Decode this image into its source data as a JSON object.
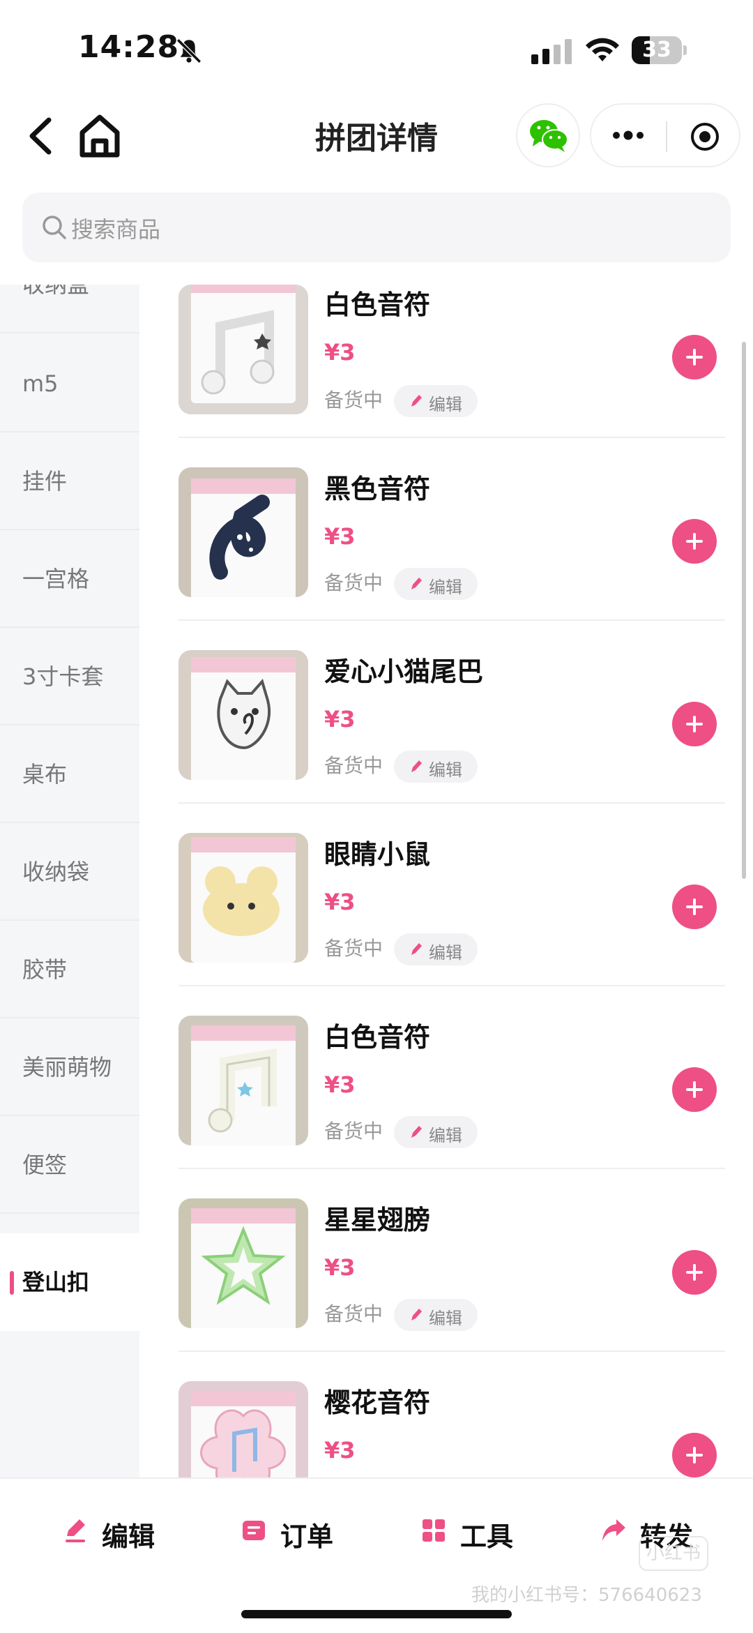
{
  "status_bar": {
    "time": "14:28",
    "battery": "33"
  },
  "nav": {
    "title": "拼团详情"
  },
  "search": {
    "placeholder": "搜索商品"
  },
  "sidebar": {
    "items": [
      {
        "label": "收纳盒"
      },
      {
        "label": "m5"
      },
      {
        "label": "挂件"
      },
      {
        "label": "一宫格"
      },
      {
        "label": "3寸卡套"
      },
      {
        "label": "桌布"
      },
      {
        "label": "收纳袋"
      },
      {
        "label": "胶带"
      },
      {
        "label": "美丽萌物"
      },
      {
        "label": "便签"
      },
      {
        "label": "登山扣"
      }
    ],
    "active": "登山扣"
  },
  "products": [
    {
      "name": "白色音符",
      "price": "¥3",
      "status": "备货中",
      "edit": "编辑"
    },
    {
      "name": "黑色音符",
      "price": "¥3",
      "status": "备货中",
      "edit": "编辑"
    },
    {
      "name": "爱心小猫尾巴",
      "price": "¥3",
      "status": "备货中",
      "edit": "编辑"
    },
    {
      "name": "眼睛小鼠",
      "price": "¥3",
      "status": "备货中",
      "edit": "编辑"
    },
    {
      "name": "白色音符",
      "price": "¥3",
      "status": "备货中",
      "edit": "编辑"
    },
    {
      "name": "星星翅膀",
      "price": "¥3",
      "status": "备货中",
      "edit": "编辑"
    },
    {
      "name": "樱花音符",
      "price": "¥3"
    }
  ],
  "bottom_bar": {
    "tabs": [
      {
        "label": "编辑",
        "icon": "edit-icon"
      },
      {
        "label": "订单",
        "icon": "order-icon"
      },
      {
        "label": "工具",
        "icon": "tools-icon"
      },
      {
        "label": "转发",
        "icon": "share-icon"
      }
    ]
  },
  "watermark": {
    "text": "我的小红书号：576640623",
    "logo": "小红书"
  },
  "colors": {
    "accent": "#ee4f85",
    "sidebar_bg": "#f5f6f8",
    "wechat_green": "#2dc100"
  }
}
